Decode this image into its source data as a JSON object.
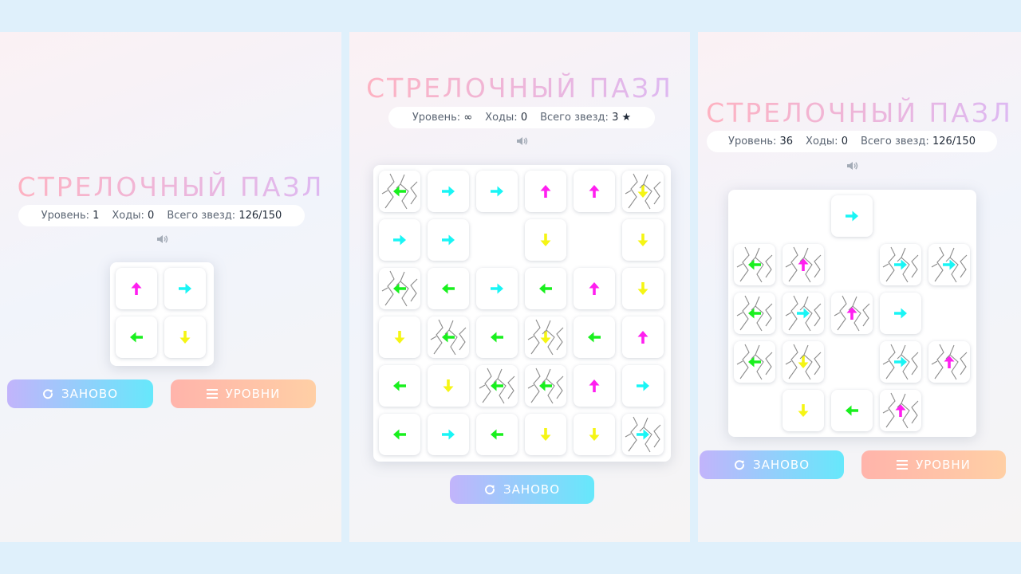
{
  "panels": [
    {
      "title": "СТРЕЛОЧНЫЙ ПАЗЛ",
      "stats": {
        "level_label": "Уровень:",
        "level_value": "1",
        "moves_label": "Ходы:",
        "moves_value": "0",
        "stars_label": "Всего звезд:",
        "stars_value": "126/150"
      },
      "buttons": {
        "restart": "ЗАНОВО",
        "levels": "УРОВНИ"
      },
      "board": {
        "rows": 2,
        "cols": 2,
        "cells": [
          {
            "r": 0,
            "c": 0,
            "dir": "up",
            "color": "#ff1ff0",
            "cracked": false
          },
          {
            "r": 0,
            "c": 1,
            "dir": "right",
            "color": "#19f5f5",
            "cracked": false
          },
          {
            "r": 1,
            "c": 0,
            "dir": "left",
            "color": "#19f01e",
            "cracked": false
          },
          {
            "r": 1,
            "c": 1,
            "dir": "down",
            "color": "#f5f514",
            "cracked": false
          }
        ]
      }
    },
    {
      "title": "СТРЕЛОЧНЫЙ ПАЗЛ",
      "stats": {
        "level_label": "Уровень:",
        "level_value": "∞",
        "moves_label": "Ходы:",
        "moves_value": "0",
        "stars_label": "Всего звезд:",
        "stars_value": "3 ★"
      },
      "buttons": {
        "restart": "ЗАНОВО"
      },
      "board": {
        "rows": 6,
        "cols": 6,
        "cells": [
          {
            "r": 0,
            "c": 0,
            "dir": "left",
            "color": "#19f01e",
            "cracked": true
          },
          {
            "r": 0,
            "c": 1,
            "dir": "right",
            "color": "#19f5f5",
            "cracked": false
          },
          {
            "r": 0,
            "c": 2,
            "dir": "right",
            "color": "#19f5f5",
            "cracked": false
          },
          {
            "r": 0,
            "c": 3,
            "dir": "up",
            "color": "#ff1ff0",
            "cracked": false
          },
          {
            "r": 0,
            "c": 4,
            "dir": "up",
            "color": "#ff1ff0",
            "cracked": false
          },
          {
            "r": 0,
            "c": 5,
            "dir": "down",
            "color": "#f5f514",
            "cracked": true
          },
          {
            "r": 1,
            "c": 0,
            "dir": "right",
            "color": "#19f5f5",
            "cracked": false
          },
          {
            "r": 1,
            "c": 1,
            "dir": "right",
            "color": "#19f5f5",
            "cracked": false
          },
          {
            "r": 1,
            "c": 3,
            "dir": "down",
            "color": "#f5f514",
            "cracked": false
          },
          {
            "r": 1,
            "c": 5,
            "dir": "down",
            "color": "#f5f514",
            "cracked": false
          },
          {
            "r": 2,
            "c": 0,
            "dir": "left",
            "color": "#19f01e",
            "cracked": true
          },
          {
            "r": 2,
            "c": 1,
            "dir": "left",
            "color": "#19f01e",
            "cracked": false
          },
          {
            "r": 2,
            "c": 2,
            "dir": "right",
            "color": "#19f5f5",
            "cracked": false
          },
          {
            "r": 2,
            "c": 3,
            "dir": "left",
            "color": "#19f01e",
            "cracked": false
          },
          {
            "r": 2,
            "c": 4,
            "dir": "up",
            "color": "#ff1ff0",
            "cracked": false
          },
          {
            "r": 2,
            "c": 5,
            "dir": "down",
            "color": "#f5f514",
            "cracked": false
          },
          {
            "r": 3,
            "c": 0,
            "dir": "down",
            "color": "#f5f514",
            "cracked": false
          },
          {
            "r": 3,
            "c": 1,
            "dir": "left",
            "color": "#19f01e",
            "cracked": true
          },
          {
            "r": 3,
            "c": 2,
            "dir": "left",
            "color": "#19f01e",
            "cracked": false
          },
          {
            "r": 3,
            "c": 3,
            "dir": "down",
            "color": "#f5f514",
            "cracked": true
          },
          {
            "r": 3,
            "c": 4,
            "dir": "left",
            "color": "#19f01e",
            "cracked": false
          },
          {
            "r": 3,
            "c": 5,
            "dir": "up",
            "color": "#ff1ff0",
            "cracked": false
          },
          {
            "r": 4,
            "c": 0,
            "dir": "left",
            "color": "#19f01e",
            "cracked": false
          },
          {
            "r": 4,
            "c": 1,
            "dir": "down",
            "color": "#f5f514",
            "cracked": false
          },
          {
            "r": 4,
            "c": 2,
            "dir": "left",
            "color": "#19f01e",
            "cracked": true
          },
          {
            "r": 4,
            "c": 3,
            "dir": "left",
            "color": "#19f01e",
            "cracked": true
          },
          {
            "r": 4,
            "c": 4,
            "dir": "up",
            "color": "#ff1ff0",
            "cracked": false
          },
          {
            "r": 4,
            "c": 5,
            "dir": "right",
            "color": "#19f5f5",
            "cracked": false
          },
          {
            "r": 5,
            "c": 0,
            "dir": "left",
            "color": "#19f01e",
            "cracked": false
          },
          {
            "r": 5,
            "c": 1,
            "dir": "right",
            "color": "#19f5f5",
            "cracked": false
          },
          {
            "r": 5,
            "c": 2,
            "dir": "left",
            "color": "#19f01e",
            "cracked": false
          },
          {
            "r": 5,
            "c": 3,
            "dir": "down",
            "color": "#f5f514",
            "cracked": false
          },
          {
            "r": 5,
            "c": 4,
            "dir": "down",
            "color": "#f5f514",
            "cracked": false
          },
          {
            "r": 5,
            "c": 5,
            "dir": "right",
            "color": "#19f5f5",
            "cracked": true
          }
        ]
      }
    },
    {
      "title": "СТРЕЛОЧНЫЙ ПАЗЛ",
      "stats": {
        "level_label": "Уровень:",
        "level_value": "36",
        "moves_label": "Ходы:",
        "moves_value": "0",
        "stars_label": "Всего звезд:",
        "stars_value": "126/150"
      },
      "buttons": {
        "restart": "ЗАНОВО",
        "levels": "УРОВНИ"
      },
      "board": {
        "rows": 5,
        "cols": 5,
        "cells": [
          {
            "r": 0,
            "c": 2,
            "dir": "right",
            "color": "#19f5f5",
            "cracked": false
          },
          {
            "r": 1,
            "c": 0,
            "dir": "left",
            "color": "#19f01e",
            "cracked": true
          },
          {
            "r": 1,
            "c": 1,
            "dir": "up",
            "color": "#ff1ff0",
            "cracked": true
          },
          {
            "r": 1,
            "c": 3,
            "dir": "right",
            "color": "#19f5f5",
            "cracked": true
          },
          {
            "r": 1,
            "c": 4,
            "dir": "right",
            "color": "#19f5f5",
            "cracked": true
          },
          {
            "r": 2,
            "c": 0,
            "dir": "left",
            "color": "#19f01e",
            "cracked": true
          },
          {
            "r": 2,
            "c": 1,
            "dir": "right",
            "color": "#19f5f5",
            "cracked": true
          },
          {
            "r": 2,
            "c": 2,
            "dir": "up",
            "color": "#ff1ff0",
            "cracked": true
          },
          {
            "r": 2,
            "c": 3,
            "dir": "right",
            "color": "#19f5f5",
            "cracked": false
          },
          {
            "r": 3,
            "c": 0,
            "dir": "left",
            "color": "#19f01e",
            "cracked": true
          },
          {
            "r": 3,
            "c": 1,
            "dir": "down",
            "color": "#f5f514",
            "cracked": true
          },
          {
            "r": 3,
            "c": 3,
            "dir": "right",
            "color": "#19f5f5",
            "cracked": true
          },
          {
            "r": 3,
            "c": 4,
            "dir": "up",
            "color": "#ff1ff0",
            "cracked": true
          },
          {
            "r": 4,
            "c": 1,
            "dir": "down",
            "color": "#f5f514",
            "cracked": false
          },
          {
            "r": 4,
            "c": 2,
            "dir": "left",
            "color": "#19f01e",
            "cracked": false
          },
          {
            "r": 4,
            "c": 3,
            "dir": "up",
            "color": "#ff1ff0",
            "cracked": true
          }
        ]
      }
    }
  ]
}
